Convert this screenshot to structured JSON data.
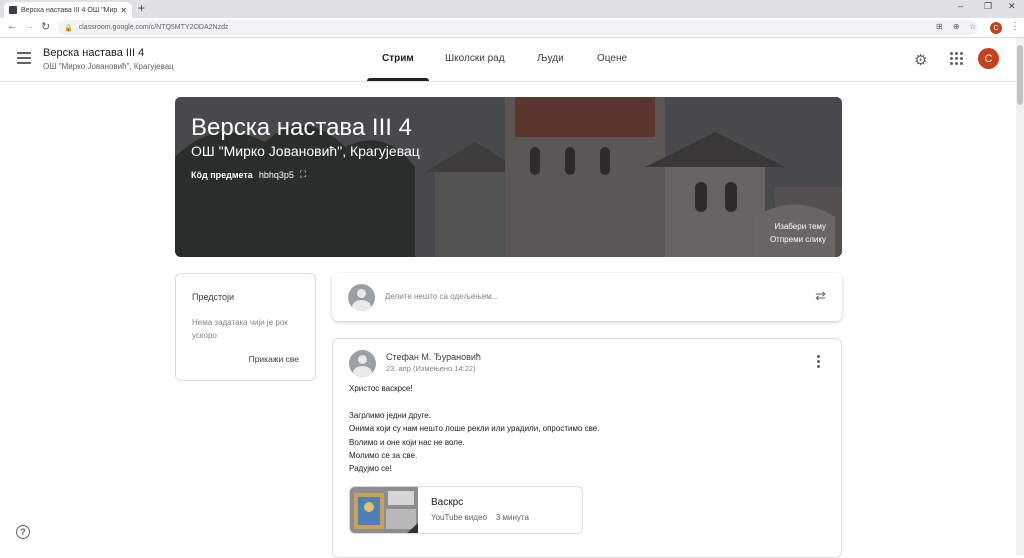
{
  "browser": {
    "tab_title": "Верска настава III 4 ОШ \"Мирко",
    "tab_close": "✕",
    "new_tab": "+",
    "url": "classroom.google.com/c/NTQ5MTY2ODA2Nzdz",
    "avatar_letter": "C"
  },
  "header": {
    "class_title": "Верска настава III 4",
    "class_subtitle": "ОШ \"Мирко Јовановић\", Крагујевац",
    "tabs": [
      "Стрим",
      "Школски рад",
      "Људи",
      "Оцене"
    ],
    "active_tab": "Стрим",
    "user_letter": "C"
  },
  "banner": {
    "title": "Верска настава III 4",
    "subtitle": "ОШ \"Мирко Јовановић\", Крагујевац",
    "code_label": "Кôд предмета",
    "code_value": "hbhq3p5",
    "choose_theme": "Изабери тему",
    "upload_photo": "Отпреми слику"
  },
  "upcoming": {
    "title": "Предстоји",
    "empty_text": "Нема задатака чији је рок ускоро",
    "view_all": "Прикажи све"
  },
  "share": {
    "placeholder": "Делите нешто са одељењем..."
  },
  "post": {
    "author": "Стефан М. Ђурановић",
    "date": "23. апр (Измењено 14:22)",
    "lines": [
      "Христос васкрсе!",
      "",
      "Загрлимо једни друге.",
      "Онима који су нам нешто лоше рекли или урадили, опростимо све.",
      "Волимо и оне који нас не воле.",
      "Молимо се за све.",
      "Радујмо се!"
    ],
    "attachment": {
      "title": "Васкрс",
      "type": "YouTube видео",
      "duration": "3 минута"
    }
  },
  "help": "?",
  "colors": {
    "accent": "#c5421b",
    "text": "#3c4043"
  }
}
